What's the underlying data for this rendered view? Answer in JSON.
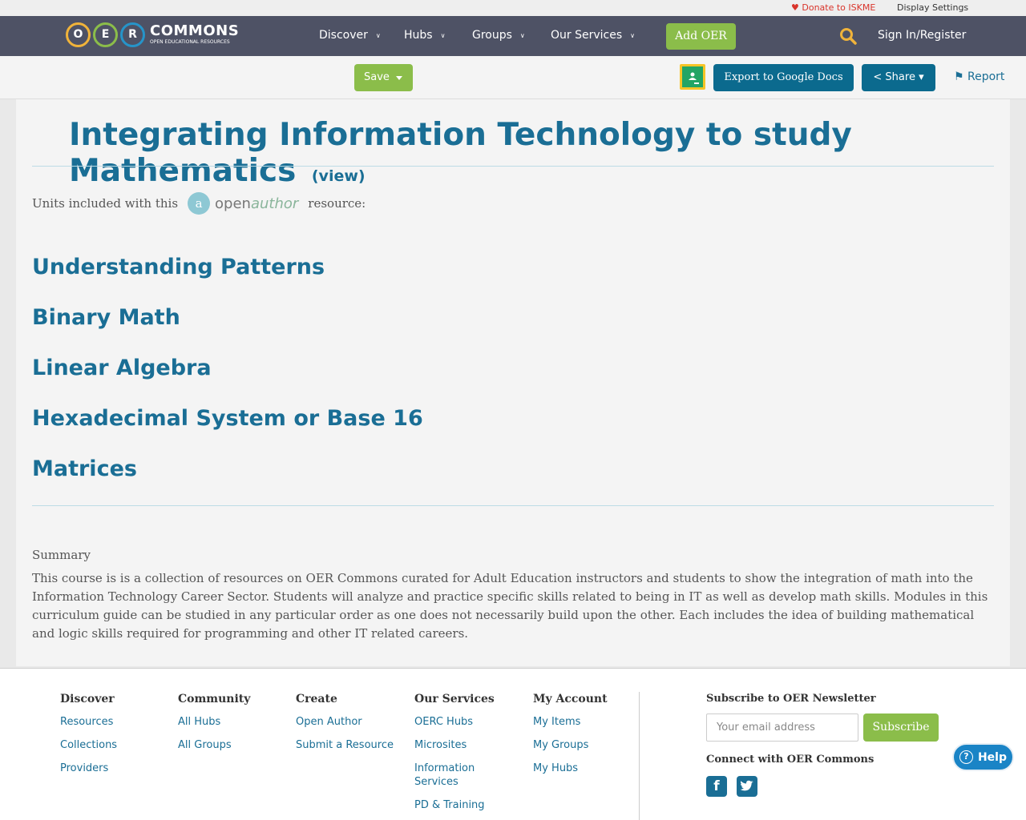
{
  "topbar": {
    "donate": "Donate to ISKME",
    "display_settings": "Display Settings"
  },
  "nav": {
    "logo_letters": [
      "O",
      "E",
      "R"
    ],
    "logo_word": "COMMONS",
    "logo_tagline": "OPEN EDUCATIONAL RESOURCES",
    "items": [
      "Discover",
      "Hubs",
      "Groups",
      "Our Services"
    ],
    "add_oer": "Add OER",
    "sign_in": "Sign In/Register"
  },
  "toolbar": {
    "save": "Save",
    "export": "Export to Google Docs",
    "share": "Share",
    "report": "Report"
  },
  "page": {
    "title": "Integrating Information Technology to study Mathematics",
    "view_link": "(view)",
    "units_prefix": "Units included with this",
    "units_suffix": "resource:",
    "openauthor_open": "open",
    "openauthor_author": "author",
    "units": [
      "Understanding Patterns",
      "Binary Math",
      "Linear Algebra",
      "Hexadecimal System or Base 16",
      "Matrices"
    ],
    "summary_label": "Summary",
    "summary_text": "This course is is a collection of resources on OER Commons curated for Adult Education instructors and students to show the integration of math into the Information Technology Career Sector. Students will analyze and practice specific skills related to being in IT as well as develop math skills. Modules in this curriculum guide can be studied in any particular order as one does not necessarily build upon the other. Each includes the idea of building mathematical and logic skills required for programming and other IT related careers."
  },
  "footer": {
    "discover": {
      "heading": "Discover",
      "links": [
        "Resources",
        "Collections",
        "Providers"
      ]
    },
    "community": {
      "heading": "Community",
      "links": [
        "All Hubs",
        "All Groups"
      ]
    },
    "create": {
      "heading": "Create",
      "links": [
        "Open Author",
        "Submit a Resource"
      ]
    },
    "services": {
      "heading": "Our Services",
      "links": [
        "OERC Hubs",
        "Microsites",
        "Information Services",
        "PD & Training"
      ]
    },
    "account": {
      "heading": "My Account",
      "links": [
        "My Items",
        "My Groups",
        "My Hubs"
      ]
    },
    "newsletter_heading": "Subscribe to OER Newsletter",
    "email_placeholder": "Your email address",
    "subscribe": "Subscribe",
    "connect_heading": "Connect with OER Commons",
    "social": [
      "facebook-icon",
      "twitter-icon"
    ]
  },
  "help": "Help",
  "colors": {
    "nav_bg": "#4e5265",
    "accent_green": "#8bbd4a",
    "link_blue": "#1a6e95",
    "button_blue": "#0b6a8e",
    "donate_red": "#d9342b"
  }
}
